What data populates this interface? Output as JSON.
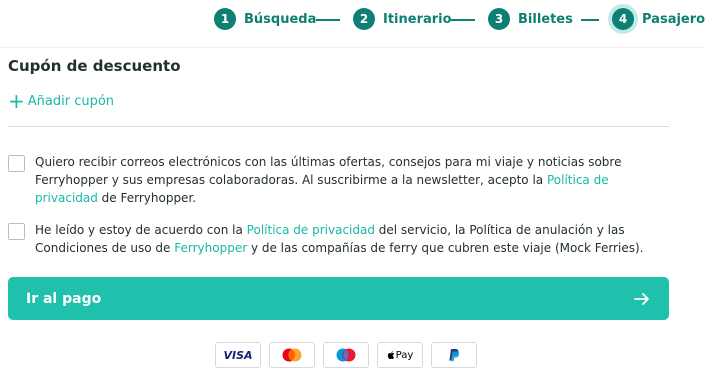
{
  "stepper": {
    "steps": [
      {
        "number": "1",
        "label": "Búsqueda"
      },
      {
        "number": "2",
        "label": "Itinerario"
      },
      {
        "number": "3",
        "label": "Billetes"
      },
      {
        "number": "4",
        "label": "Pasajeros"
      }
    ],
    "active_step": 4,
    "accent_color": "#0e7f73"
  },
  "coupon": {
    "title": "Cupón de descuento",
    "add_label": "Añadir cupón"
  },
  "consents": {
    "newsletter": {
      "text_before": "Quiero recibir correos electrónicos con las últimas ofertas, consejos para mi viaje y noticias sobre Ferryhopper y sus empresas colaboradoras. Al suscribirme a la newsletter, acepto la ",
      "link": "Política de privacidad",
      "text_after": " de Ferryhopper."
    },
    "terms": {
      "text_1": "He leído y estoy de acuerdo con la ",
      "link_1": "Política de privacidad",
      "text_2": " del servicio, la Política de anulación y las Condiciones de uso de ",
      "link_2": "Ferryhopper",
      "text_3": " y de las compañías de ferry que cubren este viaje (Mock Ferries)."
    }
  },
  "pay_button": {
    "label": "Ir al pago",
    "color": "#1fc1ad"
  },
  "payment_methods": {
    "visa": "VISA",
    "mastercard": "mastercard-icon",
    "maestro": "maestro-icon",
    "apple_pay": "Pay",
    "paypal": "paypal-icon"
  }
}
